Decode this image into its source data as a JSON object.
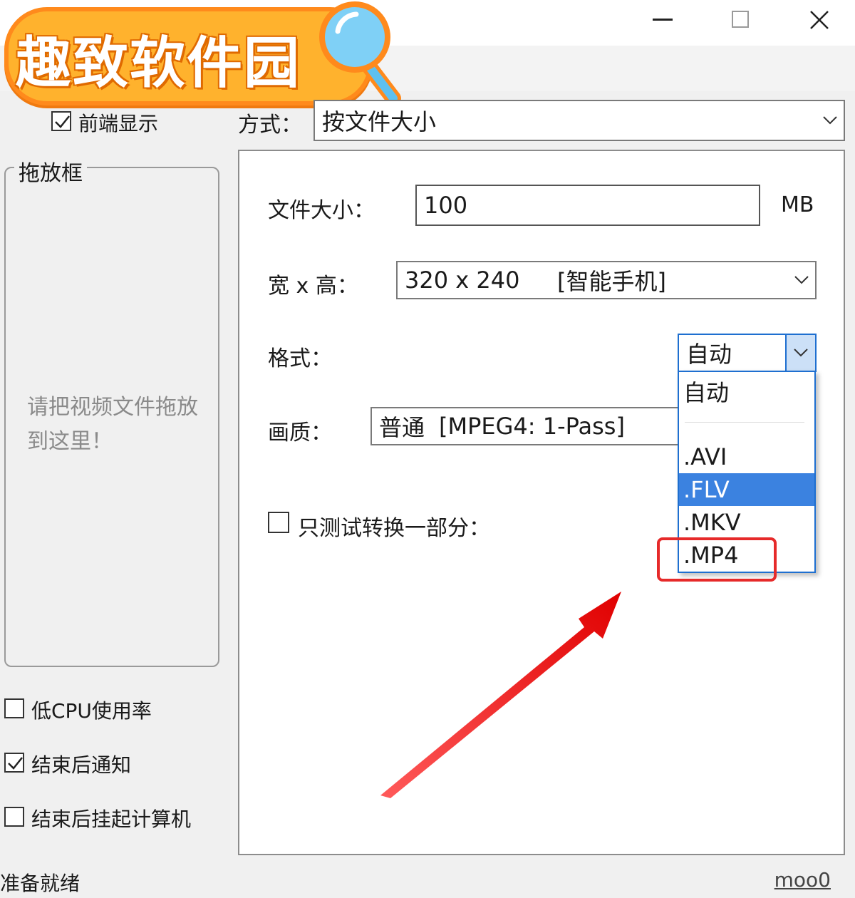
{
  "watermark": {
    "text": "趣致软件园"
  },
  "window": {
    "controls": {
      "minimize": "minimize-icon",
      "maximize": "maximize-icon",
      "close": "close-icon"
    }
  },
  "left": {
    "topmost_label": "前端显示",
    "topmost_checked": true,
    "dropbox_title": "拖放框",
    "drop_hint": "请把视频文件拖放到这里！",
    "options": [
      {
        "label": "低CPU使用率",
        "checked": false
      },
      {
        "label": "结束后通知",
        "checked": true
      },
      {
        "label": "结束后挂起计算机",
        "checked": false
      }
    ]
  },
  "mode": {
    "label": "方式：",
    "value": "按文件大小"
  },
  "form": {
    "filesize_label": "文件大小：",
    "filesize_value": "100",
    "filesize_unit": "MB",
    "wh_label": "宽 x 高：",
    "wh_value": "320 x 240",
    "wh_note": "[智能手机]",
    "format_label": "格式：",
    "format_value": "自动",
    "quality_label": "画质：",
    "quality_value": "普通",
    "quality_note": "[MPEG4: 1-Pass]",
    "test_label": "只测试转换一部分：",
    "test_checked": false
  },
  "format_options": [
    "自动",
    ".AVI",
    ".FLV",
    ".MKV",
    ".MP4"
  ],
  "format_selected": ".FLV",
  "status": {
    "text": "准备就绪",
    "link": "moo0"
  },
  "colors": {
    "accent": "#3b82e0",
    "highlight": "#e62a2a",
    "logo": "#ffb22d"
  }
}
